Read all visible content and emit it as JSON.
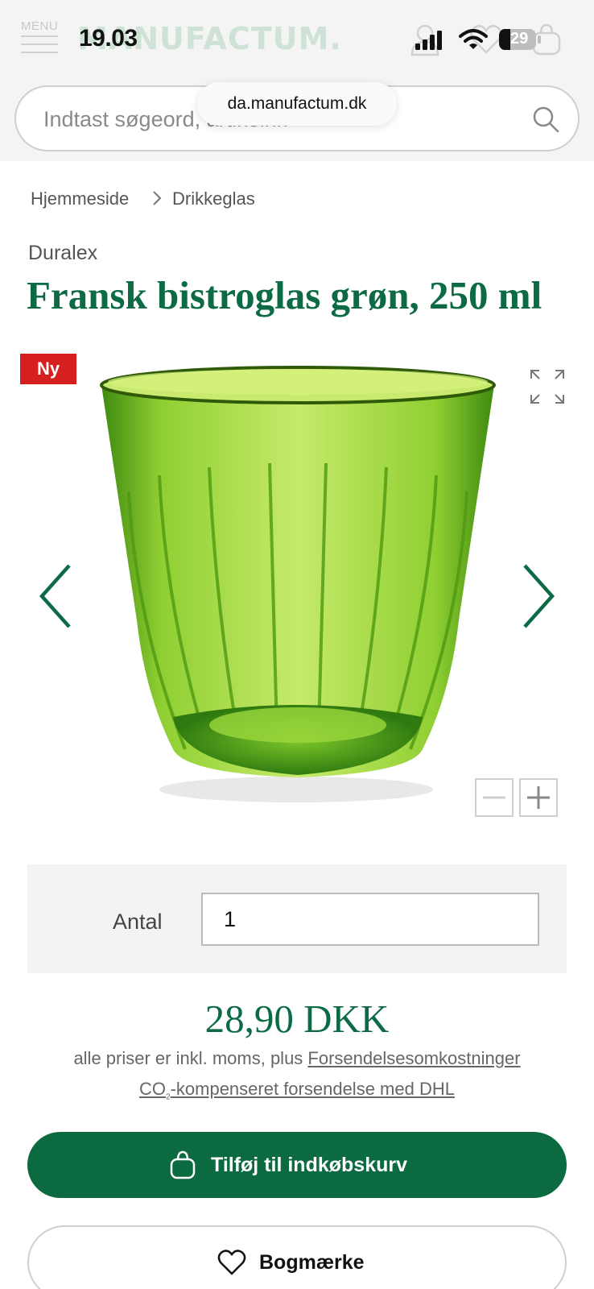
{
  "status_bar": {
    "time": "19.03",
    "battery_level": "29",
    "icons": [
      "signal-icon",
      "wifi-icon",
      "battery-icon"
    ]
  },
  "header": {
    "menu_label": "MENU",
    "logo_text": "MANUFACTUM.",
    "icons": [
      "menu-icon",
      "account-icon",
      "heart-icon",
      "shopping-bag-icon"
    ]
  },
  "search": {
    "placeholder": "Indtast søgeord, artikelnr.",
    "url": "da.manufactum.dk"
  },
  "breadcrumb": {
    "items": [
      "Hjemmeside",
      "Drikkeglas"
    ]
  },
  "product": {
    "brand": "Duralex",
    "title": "Fransk bistroglas grøn, 250 ml",
    "badge": "Ny",
    "price": "28,90 DKK",
    "price_note_prefix": "alle priser er inkl. moms, plus ",
    "shipping_link": "Forsendelsesomkostninger",
    "co2_prefix": "CO",
    "co2_sub": "2",
    "co2_text": "-kompenseret forsendelse med DHL"
  },
  "quantity": {
    "label": "Antal",
    "value": "1"
  },
  "buttons": {
    "add_to_cart": "Tilføj til indkøbskurv",
    "bookmark": "Bogmærke"
  },
  "colors": {
    "brand_green": "#0c6b45",
    "button_green": "#0b6a3f",
    "badge_red": "#d61f1f",
    "glass_green": "#6fb51e"
  }
}
